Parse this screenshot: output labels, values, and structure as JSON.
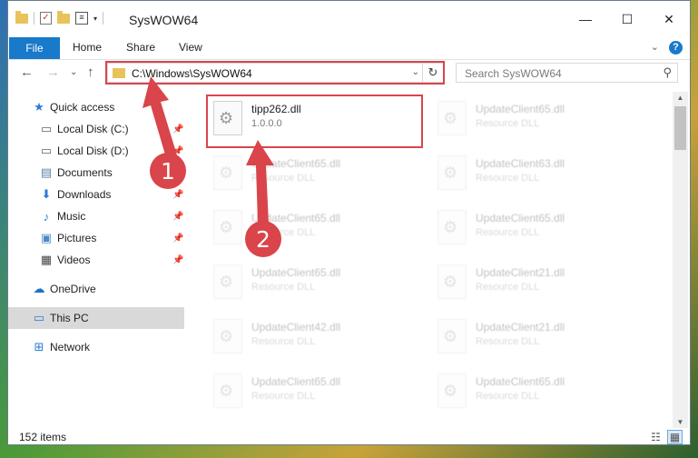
{
  "window": {
    "title": "SysWOW64",
    "controls": {
      "minimize": "—",
      "maximize": "☐",
      "close": "✕"
    }
  },
  "ribbon": {
    "file_label": "File",
    "tabs": [
      "Home",
      "Share",
      "View"
    ],
    "help": "?"
  },
  "address_bar": {
    "path": "C:\\Windows\\SysWOW64",
    "dropdown_glyph": "⌄",
    "refresh_glyph": "↻"
  },
  "search": {
    "placeholder": "Search SysWOW64",
    "icon": "search-icon"
  },
  "nav": {
    "back": "←",
    "forward": "→",
    "recent": "⌄",
    "up": "↑"
  },
  "sidebar": {
    "items": [
      {
        "label": "Quick access",
        "icon": "star-icon",
        "pinned": false
      },
      {
        "label": "Local Disk (C:)",
        "icon": "drive-icon",
        "pinned": true
      },
      {
        "label": "Local Disk (D:)",
        "icon": "drive-icon",
        "pinned": true
      },
      {
        "label": "Documents",
        "icon": "documents-icon",
        "pinned": true
      },
      {
        "label": "Downloads",
        "icon": "downloads-icon",
        "pinned": true
      },
      {
        "label": "Music",
        "icon": "music-icon",
        "pinned": true
      },
      {
        "label": "Pictures",
        "icon": "pictures-icon",
        "pinned": true
      },
      {
        "label": "Videos",
        "icon": "videos-icon",
        "pinned": true
      },
      {
        "label": "OneDrive",
        "icon": "cloud-icon",
        "pinned": false
      },
      {
        "label": "This PC",
        "icon": "computer-icon",
        "pinned": false,
        "selected": true
      },
      {
        "label": "Network",
        "icon": "network-icon",
        "pinned": false
      }
    ]
  },
  "files": {
    "highlighted": {
      "name": "tipp262.dll",
      "sub": "1.0.0.0"
    },
    "left_column": [
      {
        "name": "UpdateClient65.dll",
        "sub": "Resource DLL"
      },
      {
        "name": "UpdateClient65.dll",
        "sub": "Resource DLL"
      },
      {
        "name": "UpdateClient65.dll",
        "sub": "Resource DLL"
      },
      {
        "name": "UpdateClient42.dll",
        "sub": "Resource DLL"
      },
      {
        "name": "UpdateClient65.dll",
        "sub": "Resource DLL"
      }
    ],
    "right_column": [
      {
        "name": "UpdateClient65.dll",
        "sub": "Resource DLL"
      },
      {
        "name": "UpdateClient63.dll",
        "sub": "Resource DLL"
      },
      {
        "name": "UpdateClient65.dll",
        "sub": "Resource DLL"
      },
      {
        "name": "UpdateClient21.dll",
        "sub": "Resource DLL"
      },
      {
        "name": "UpdateClient21.dll",
        "sub": "Resource DLL"
      },
      {
        "name": "UpdateClient65.dll",
        "sub": "Resource DLL"
      }
    ]
  },
  "status": {
    "item_count": "152 items"
  },
  "callouts": {
    "one": "1",
    "two": "2",
    "color": "#d9454a"
  }
}
